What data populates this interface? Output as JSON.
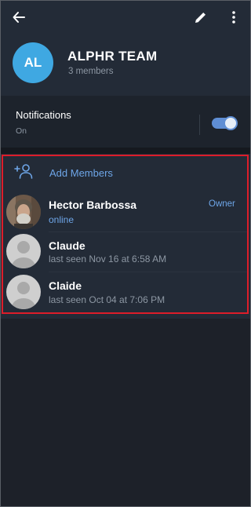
{
  "header": {
    "back_icon": "arrow-left-icon",
    "edit_icon": "pencil-icon",
    "more_icon": "more-vertical-icon",
    "avatar_initials": "AL",
    "avatar_color": "#3fa8e2",
    "title": "ALPHR TEAM",
    "subtitle": "3 members"
  },
  "notifications": {
    "label": "Notifications",
    "state": "On",
    "enabled": true
  },
  "members": {
    "add_label": "Add Members",
    "add_icon": "add-person-icon",
    "list": [
      {
        "name": "Hector Barbossa",
        "status": "online",
        "role": "Owner",
        "avatar": "photo"
      },
      {
        "name": "Claude",
        "status": "last seen Nov 16 at 6:58 AM",
        "avatar": "default-person-icon"
      },
      {
        "name": "Claide",
        "status": "last seen Oct 04 at 7:06 PM",
        "avatar": "default-person-icon"
      }
    ]
  },
  "colors": {
    "accent": "#6ea6e8",
    "highlight": "#dd1d2a",
    "background": "#1d2129"
  }
}
